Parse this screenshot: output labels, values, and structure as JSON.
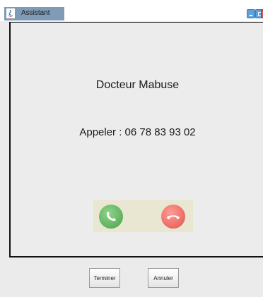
{
  "window": {
    "title": "Assistant"
  },
  "call": {
    "caller_name": "Docteur Mabuse",
    "call_line": "Appeler : 06 78 83 93 02"
  },
  "icons": {
    "answer": "phone-answer-icon",
    "hangup": "phone-hangup-icon",
    "app": "java-app-icon"
  },
  "footer": {
    "finish_label": "Terminer",
    "cancel_label": "Annuler"
  },
  "colors": {
    "title_tab": "#7f9bb6",
    "answer": "#4aa24a",
    "hangup": "#e3534d",
    "call_panel": "#e9e6d2"
  }
}
